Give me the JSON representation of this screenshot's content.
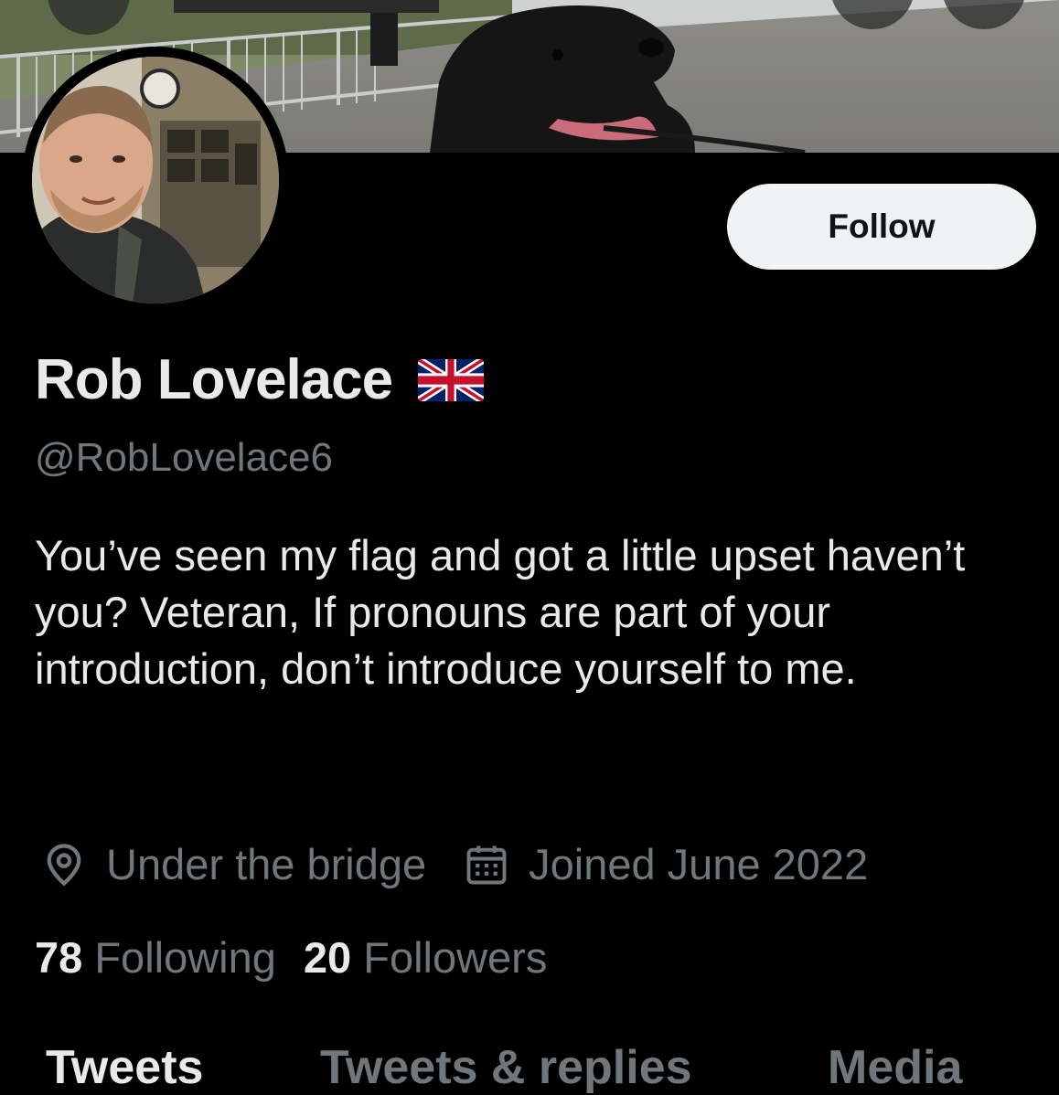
{
  "profile": {
    "name": "Rob Lovelace",
    "flag_icon": "uk-flag-icon",
    "handle": "@RobLovelace6",
    "bio": "You’ve seen my flag and got a little upset haven’t you? Veteran, If pronouns are part of your introduction, don’t introduce yourself to me.",
    "location": "Under the bridge",
    "joined": "Joined June 2022"
  },
  "actions": {
    "follow_label": "Follow"
  },
  "stats": {
    "following_count": "78",
    "following_label": "Following",
    "followers_count": "20",
    "followers_label": "Followers"
  },
  "tabs": [
    {
      "label": "Tweets"
    },
    {
      "label": "Tweets & replies"
    },
    {
      "label": "Media"
    }
  ],
  "icons": {
    "location": "location-pin-icon",
    "calendar": "calendar-icon",
    "back": "back-icon",
    "search": "search-icon",
    "more": "more-icon"
  },
  "colors": {
    "background": "#000000",
    "primary_text": "#e7e9ea",
    "secondary_text": "#71767b",
    "follow_button_bg": "#eff3f4"
  }
}
